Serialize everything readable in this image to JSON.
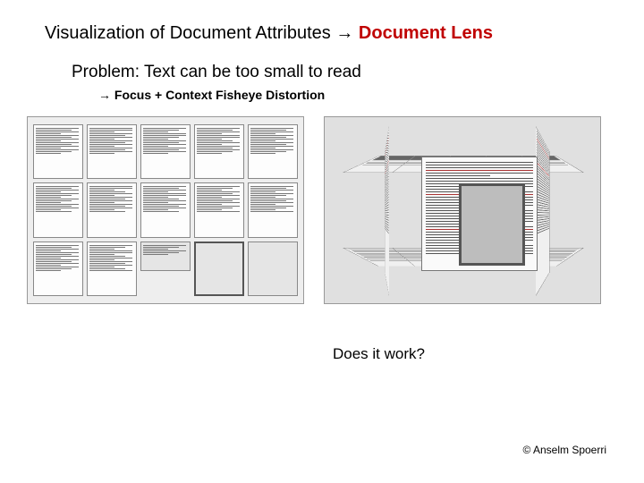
{
  "title": {
    "prefix": "Visualization of Document Attributes ",
    "arrow": "→",
    "highlight": " Document Lens"
  },
  "problem": "Problem: Text can be too small to read",
  "subline": {
    "arrow": "→",
    "text": " Focus + Context Fisheye Distortion"
  },
  "figure_left": {
    "name": "document-grid-overview"
  },
  "figure_right": {
    "name": "document-lens-fisheye"
  },
  "question": "Does it work?",
  "copyright": "© Anselm Spoerri"
}
